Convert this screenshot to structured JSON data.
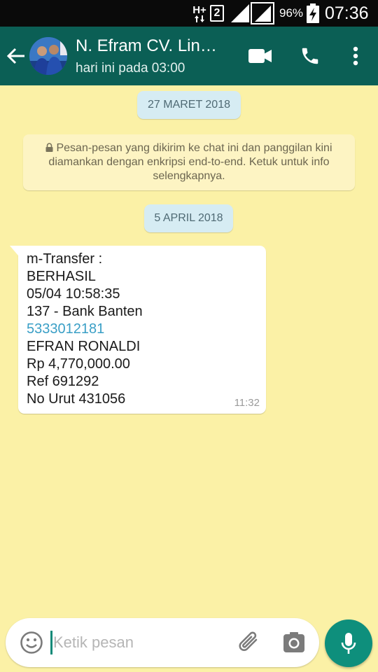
{
  "status_bar": {
    "network_type": "H+",
    "sim_slot": "2",
    "battery_percent": "96%",
    "time": "07:36"
  },
  "header": {
    "contact_name": "N. Efram CV. Lin…",
    "last_seen": "hari ini pada 03:00",
    "icons": [
      "back-arrow-icon",
      "video-call-icon",
      "phone-call-icon",
      "more-vert-icon"
    ]
  },
  "chat": {
    "date_chips": [
      "27 MARET 2018",
      "5 APRIL 2018"
    ],
    "encryption_notice": "Pesan-pesan yang dikirim ke chat ini dan panggilan kini diamankan dengan enkripsi end-to-end. Ketuk untuk info selengkapnya.",
    "message": {
      "lines": [
        "m-Transfer :",
        "BERHASIL",
        "05/04 10:58:35",
        "137 - Bank Banten",
        "5333012181",
        "EFRAN RONALDI",
        "Rp 4,770,000.00",
        "Ref 691292",
        "No Urut 431056"
      ],
      "time": "11:32"
    }
  },
  "composer": {
    "placeholder": "Ketik pesan"
  },
  "colors": {
    "app_bar": "#0b5f55",
    "chat_background": "#fbf1a6",
    "accent": "#0e8f7c",
    "link": "#3a9fc6"
  }
}
